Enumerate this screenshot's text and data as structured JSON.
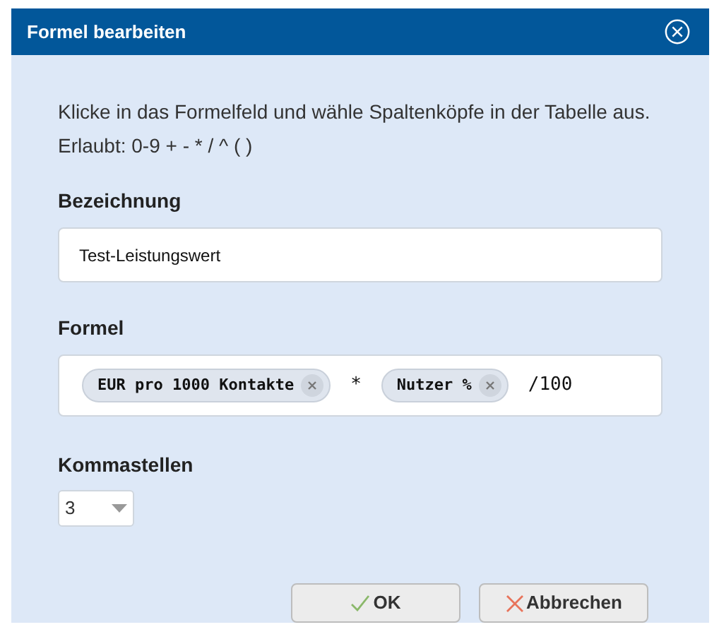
{
  "window": {
    "title": "Formel bearbeiten"
  },
  "instructions": [
    "Klicke in das Formelfeld und wähle Spaltenköpfe in der Tabelle aus.",
    "Erlaubt: 0-9 + - * / ^ ( )"
  ],
  "name_field": {
    "label": "Bezeichnung",
    "value": "Test-Leistungswert"
  },
  "formula": {
    "label": "Formel",
    "tokens": [
      {
        "kind": "chip",
        "text": "EUR pro 1000 Kontakte"
      },
      {
        "kind": "operator",
        "text": "*"
      },
      {
        "kind": "chip",
        "text": "Nutzer %"
      },
      {
        "kind": "operator",
        "text": "/100"
      }
    ]
  },
  "decimals": {
    "label": "Kommastellen",
    "value": "3"
  },
  "buttons": [
    {
      "kind": "ok",
      "label": "OK"
    },
    {
      "kind": "cancel",
      "label": "Abbrechen"
    }
  ]
}
